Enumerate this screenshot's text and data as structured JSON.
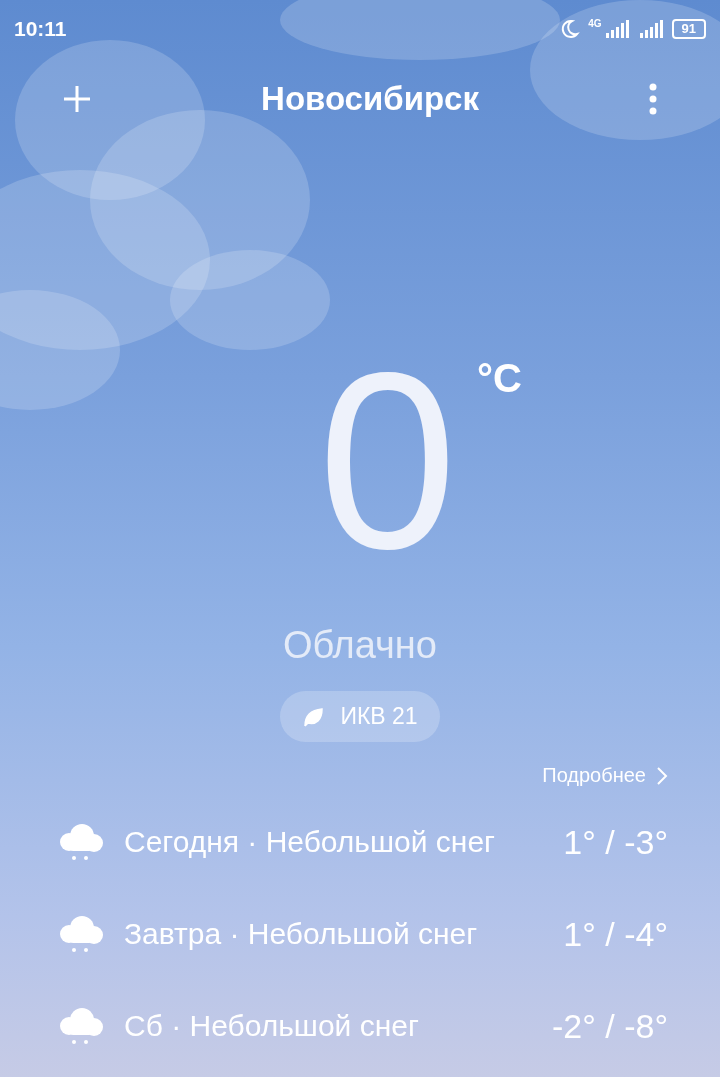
{
  "status_bar": {
    "time": "10:11",
    "network": "4G",
    "battery": "91"
  },
  "header": {
    "city": "Новосибирск"
  },
  "current": {
    "temperature": "0",
    "unit": "°C",
    "condition": "Облачно",
    "aqi": "ИКВ 21"
  },
  "more_link": "Подробнее",
  "forecast": [
    {
      "label": "Сегодня · Небольшой снег",
      "temps": "1° / -3°"
    },
    {
      "label": "Завтра · Небольшой снег",
      "temps": "1° / -4°"
    },
    {
      "label": "Сб · Небольшой снег",
      "temps": "-2° / -8°"
    }
  ]
}
